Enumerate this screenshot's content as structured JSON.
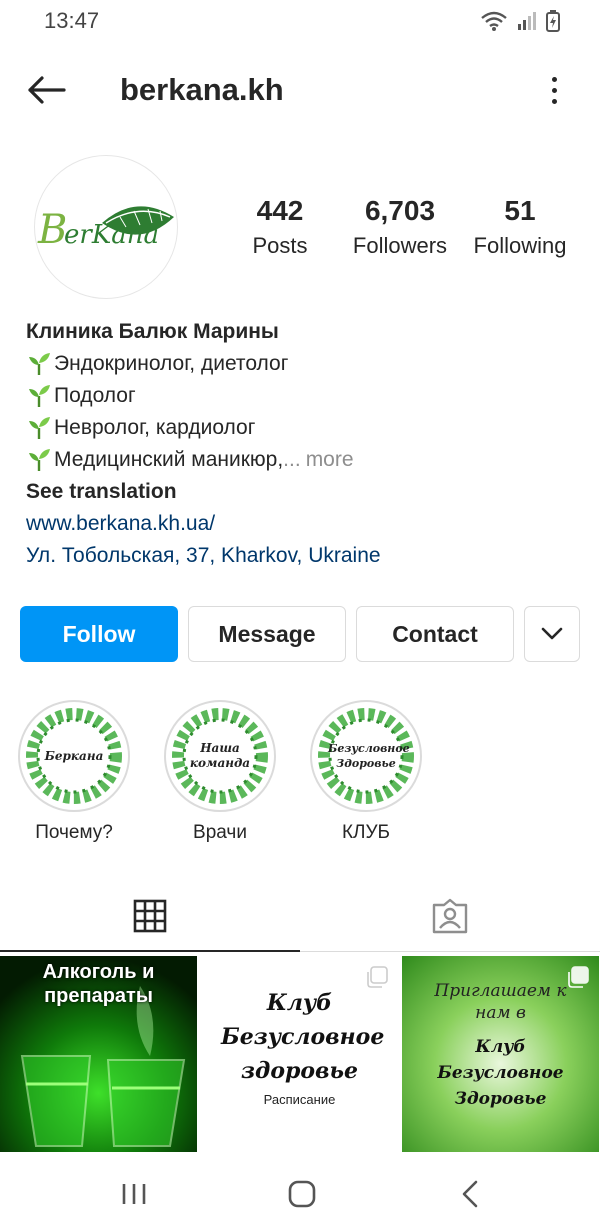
{
  "status": {
    "time": "13:47"
  },
  "profile": {
    "username": "berkana.kh",
    "avatar_logo_text": "BerKana",
    "stats": [
      {
        "value": "442",
        "label": "Posts"
      },
      {
        "value": "6,703",
        "label": "Followers"
      },
      {
        "value": "51",
        "label": "Following"
      }
    ],
    "bio": {
      "name": "Клиника Балюк Марины",
      "lines": [
        "Эндокринолог, диетолог",
        "Подолог",
        "Невролог, кардиолог",
        "Медицинский маникюр,"
      ],
      "ellipsis": "...",
      "more_label": "more",
      "see_translation": "See translation",
      "website": "www.berkana.kh.ua/",
      "address": "Ул. Тобольская,  37, Kharkov, Ukraine"
    }
  },
  "actions": {
    "follow": "Follow",
    "message": "Message",
    "contact": "Contact"
  },
  "highlights": [
    {
      "inner_text": "Беркана",
      "label": "Почему?"
    },
    {
      "inner_text": "Наша команда",
      "label": "Врачи"
    },
    {
      "inner_text": "Безусловное Здоровье",
      "label": "КЛУБ"
    }
  ],
  "posts": [
    {
      "text": "Алкоголь и препараты"
    },
    {
      "text": "Клуб Безусловное здоровье",
      "sub": "Расписание"
    },
    {
      "top": "Приглашаем к нам в",
      "text": "Клуб Безусловное Здоровье"
    }
  ],
  "colors": {
    "follow_blue": "#0095f6",
    "link": "#00376b",
    "leaf_green": "#5bb85a"
  }
}
